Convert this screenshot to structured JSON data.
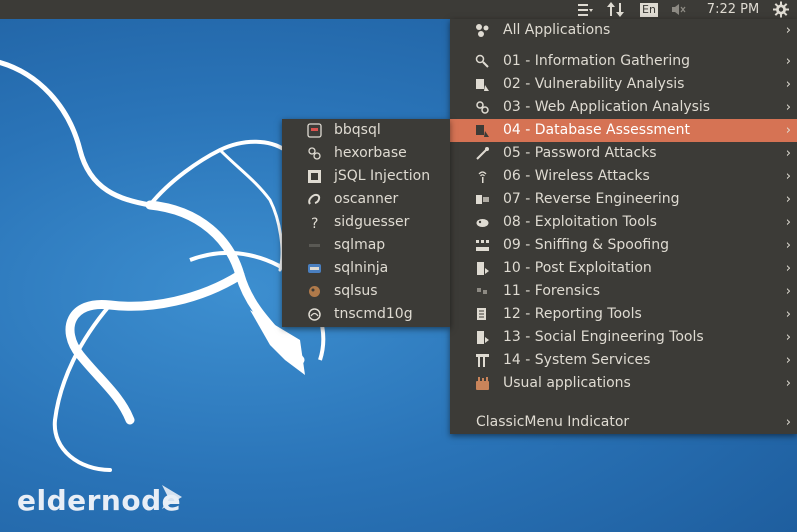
{
  "panel": {
    "indicators": [
      "menu-icon",
      "network-icon",
      "keyboard-layout-icon",
      "volume-muted-icon",
      "system-gear-icon"
    ],
    "language": "En",
    "clock": "7:22 PM"
  },
  "menu": {
    "items": [
      {
        "label": "All Applications",
        "icon": "all-apps-icon",
        "arrow": "›"
      },
      {
        "label": "01 - Information Gathering",
        "icon": "magnifier-icon",
        "arrow": "›"
      },
      {
        "label": "02 - Vulnerability Analysis",
        "icon": "vuln-icon",
        "arrow": "›"
      },
      {
        "label": "03 - Web Application Analysis",
        "icon": "web-icon",
        "arrow": "›"
      },
      {
        "label": "04 - Database Assessment",
        "icon": "database-icon",
        "arrow": "›",
        "selected": true
      },
      {
        "label": "05 - Password Attacks",
        "icon": "password-icon",
        "arrow": "›"
      },
      {
        "label": "06 - Wireless Attacks",
        "icon": "wireless-icon",
        "arrow": "›"
      },
      {
        "label": "07 - Reverse Engineering",
        "icon": "reverse-icon",
        "arrow": "›"
      },
      {
        "label": "08 - Exploitation Tools",
        "icon": "exploit-icon",
        "arrow": "›"
      },
      {
        "label": "09 - Sniffing & Spoofing",
        "icon": "sniff-icon",
        "arrow": "›"
      },
      {
        "label": "10 - Post Exploitation",
        "icon": "post-exploit-icon",
        "arrow": "›"
      },
      {
        "label": "11 - Forensics",
        "icon": "forensics-icon",
        "arrow": "›"
      },
      {
        "label": "12 - Reporting Tools",
        "icon": "reporting-icon",
        "arrow": "›"
      },
      {
        "label": "13 - Social Engineering Tools",
        "icon": "social-icon",
        "arrow": "›"
      },
      {
        "label": "14 - System Services",
        "icon": "services-icon",
        "arrow": "›"
      },
      {
        "label": "Usual applications",
        "icon": "usual-apps-icon",
        "arrow": "›"
      },
      {
        "label": "ClassicMenu Indicator",
        "icon": "",
        "arrow": "›"
      }
    ]
  },
  "submenu": {
    "items": [
      {
        "label": "bbqsql",
        "icon": "bbqsql-icon"
      },
      {
        "label": "hexorbase",
        "icon": "hexorbase-icon"
      },
      {
        "label": "jSQL Injection",
        "icon": "jsql-icon"
      },
      {
        "label": "oscanner",
        "icon": "oscanner-icon"
      },
      {
        "label": "sidguesser",
        "icon": "sidguesser-icon"
      },
      {
        "label": "sqlmap",
        "icon": "sqlmap-icon"
      },
      {
        "label": "sqlninja",
        "icon": "sqlninja-icon"
      },
      {
        "label": "sqlsus",
        "icon": "sqlsus-icon"
      },
      {
        "label": "tnscmd10g",
        "icon": "tnscmd10g-icon"
      }
    ]
  },
  "wallpaper": {
    "brand": "eldernode"
  },
  "colors": {
    "panel_bg": "#3c3b37",
    "menu_text": "#dfdbd2",
    "highlight": "#d67354",
    "desktop": "#2a74b8"
  }
}
